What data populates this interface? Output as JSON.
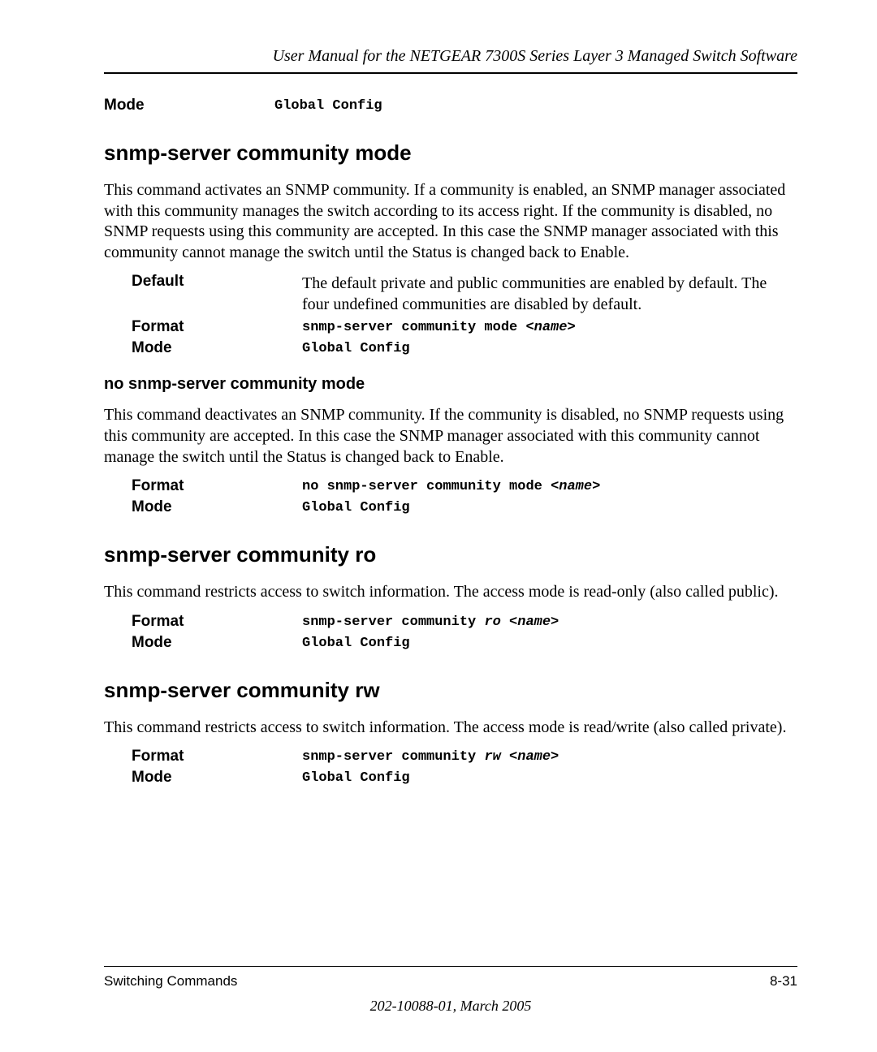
{
  "header": {
    "title": "User Manual for the NETGEAR 7300S Series Layer 3 Managed Switch Software"
  },
  "top_param": {
    "mode_label": "Mode",
    "mode_value": "Global Config"
  },
  "section1": {
    "heading": "snmp-server community mode",
    "body": "This command activates an SNMP community. If a community is enabled, an SNMP manager associated with this community manages the switch according to its access right. If the community is disabled, no SNMP requests using this community are accepted. In this case the SNMP manager associated with this community cannot manage the switch until the Status is changed back to Enable.",
    "default_label": "Default",
    "default_value": "The default private and public communities are enabled by default. The four undefined communities are disabled by default.",
    "format_label": "Format",
    "format_value_pre": "snmp-server community mode ",
    "format_value_arg": "<name>",
    "mode_label": "Mode",
    "mode_value": "Global Config"
  },
  "section1_no": {
    "heading": "no snmp-server community mode",
    "body": "This command deactivates an SNMP community. If the community is disabled, no SNMP requests using this community are accepted. In this case the SNMP manager associated with this community cannot manage the switch until the Status is changed back to Enable.",
    "format_label": "Format",
    "format_value_pre": "no snmp-server community mode ",
    "format_value_arg": "<name>",
    "mode_label": "Mode",
    "mode_value": "Global Config"
  },
  "section2": {
    "heading": "snmp-server community ro",
    "body": "This command restricts access to switch information. The access mode is read-only (also called public).",
    "format_label": "Format",
    "format_value_pre": "snmp-server community ",
    "format_value_kw": "ro ",
    "format_value_arg": "<name>",
    "mode_label": "Mode",
    "mode_value": "Global Config"
  },
  "section3": {
    "heading": "snmp-server community rw",
    "body": "This command restricts access to switch information. The access mode is read/write (also called private).",
    "format_label": "Format",
    "format_value_pre": "snmp-server community ",
    "format_value_kw": "rw ",
    "format_value_arg": "<name>",
    "mode_label": "Mode",
    "mode_value": "Global Config"
  },
  "footer": {
    "left": "Switching Commands",
    "right": "8-31",
    "center": "202-10088-01, March 2005"
  }
}
